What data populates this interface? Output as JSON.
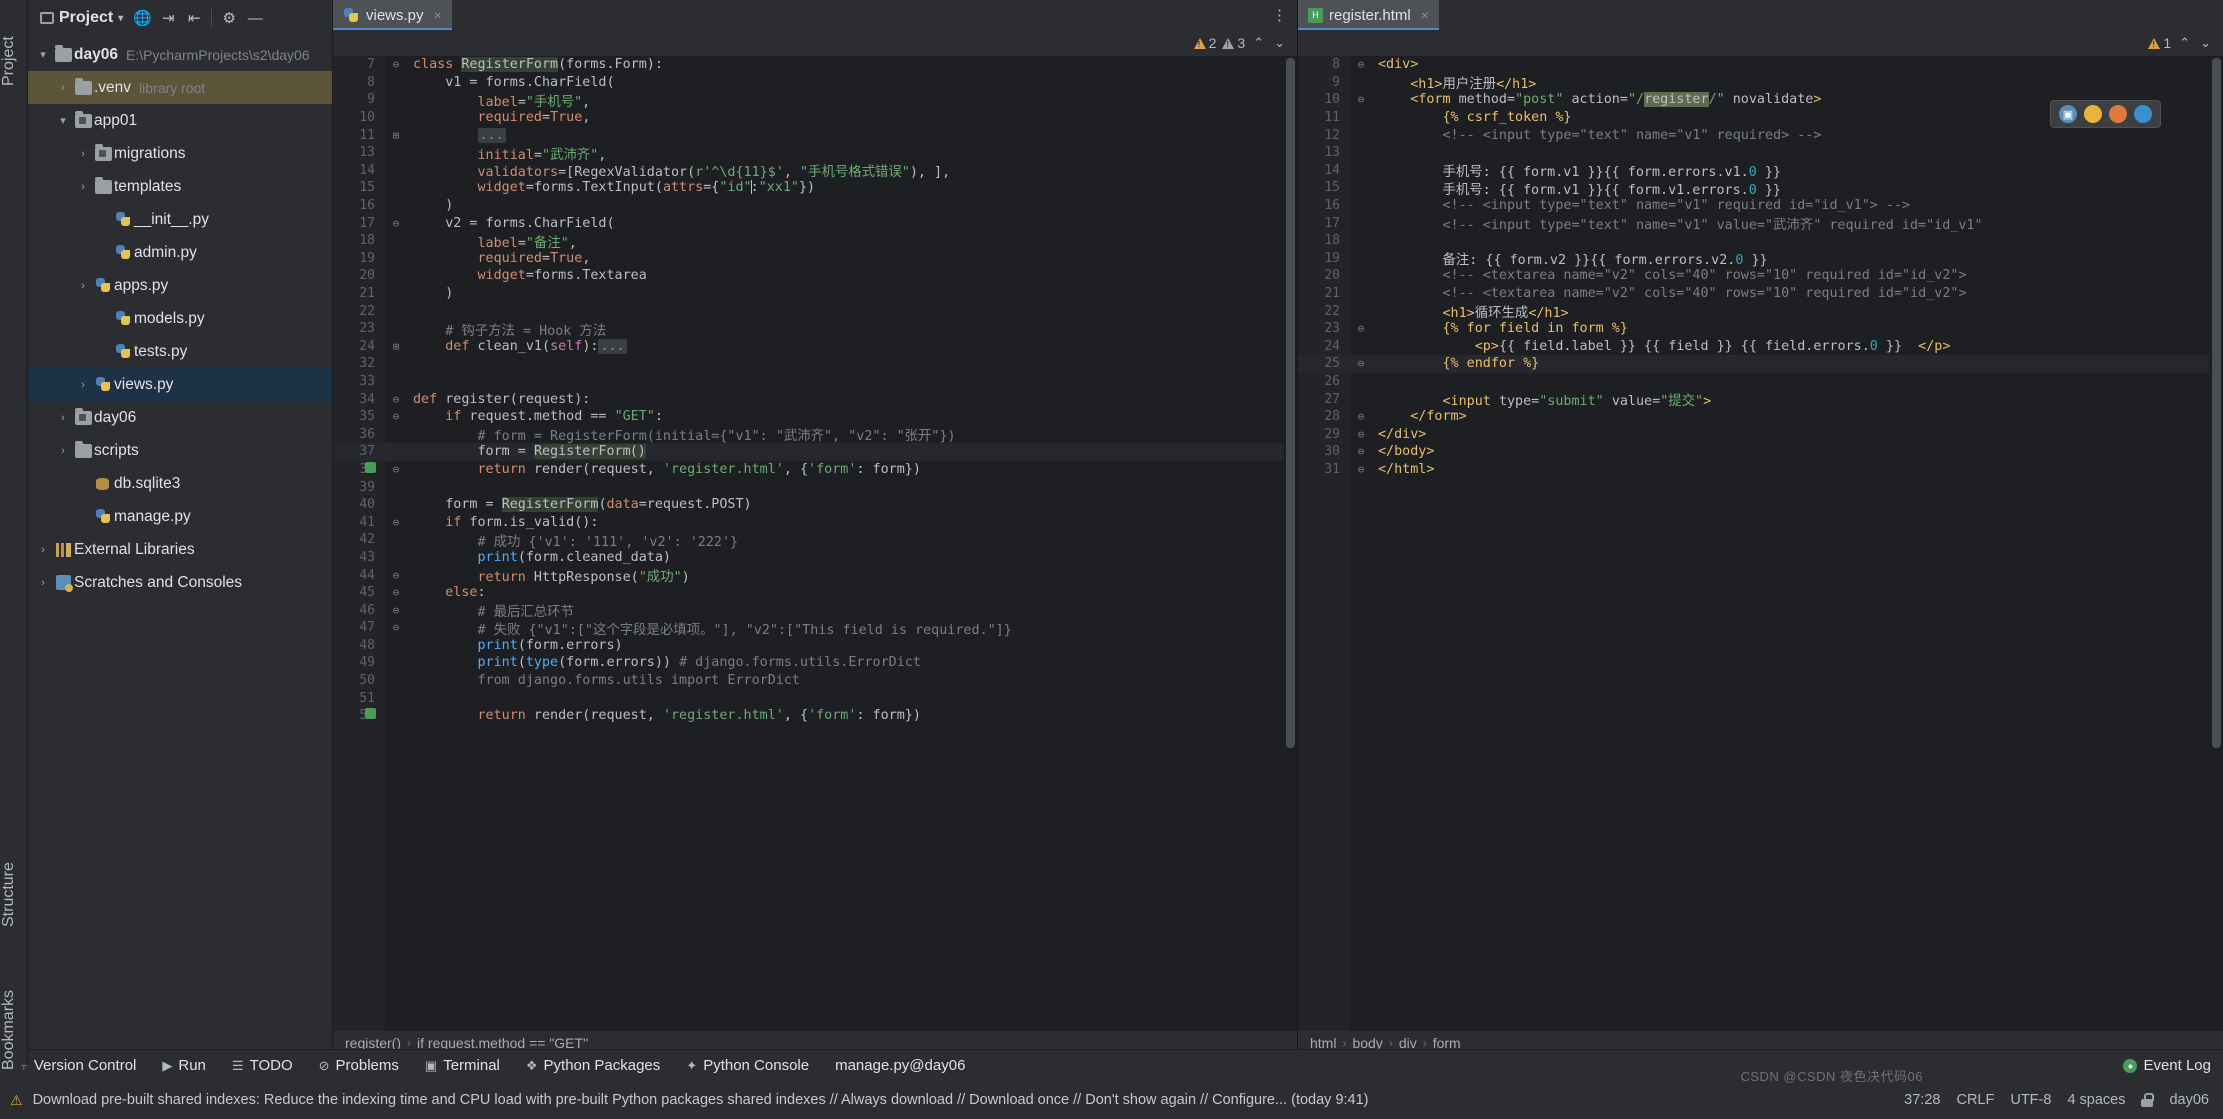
{
  "project_panel": {
    "title": "Project",
    "toolbar_icons": [
      "project-view-icon",
      "globe-icon",
      "collapse-icon",
      "expand-icon",
      "gear-icon",
      "minimize-icon"
    ],
    "tree": [
      {
        "label": "day06",
        "tag": "E:\\PycharmProjects\\s2\\day06",
        "icon": "folder-icon",
        "arrow": "▾",
        "indent": 0,
        "bold": true,
        "state": "normal"
      },
      {
        "label": ".venv",
        "tag": "library root",
        "icon": "folder-icon",
        "arrow": "›",
        "indent": 1,
        "bold": false,
        "state": "venv"
      },
      {
        "label": "app01",
        "tag": "",
        "icon": "module-folder-icon",
        "arrow": "▾",
        "indent": 1,
        "bold": false,
        "state": "normal"
      },
      {
        "label": "migrations",
        "tag": "",
        "icon": "module-folder-icon",
        "arrow": "›",
        "indent": 2,
        "bold": false,
        "state": "normal"
      },
      {
        "label": "templates",
        "tag": "",
        "icon": "folder-icon",
        "arrow": "›",
        "indent": 2,
        "bold": false,
        "state": "normal"
      },
      {
        "label": "__init__.py",
        "tag": "",
        "icon": "python-file-icon",
        "arrow": "",
        "indent": 3,
        "bold": false,
        "state": "normal"
      },
      {
        "label": "admin.py",
        "tag": "",
        "icon": "python-file-icon",
        "arrow": "",
        "indent": 3,
        "bold": false,
        "state": "normal"
      },
      {
        "label": "apps.py",
        "tag": "",
        "icon": "python-file-icon",
        "arrow": "›",
        "indent": 2,
        "bold": false,
        "state": "normal"
      },
      {
        "label": "models.py",
        "tag": "",
        "icon": "python-file-icon",
        "arrow": "",
        "indent": 3,
        "bold": false,
        "state": "normal"
      },
      {
        "label": "tests.py",
        "tag": "",
        "icon": "python-file-icon",
        "arrow": "",
        "indent": 3,
        "bold": false,
        "state": "normal"
      },
      {
        "label": "views.py",
        "tag": "",
        "icon": "python-file-icon",
        "arrow": "›",
        "indent": 2,
        "bold": false,
        "state": "selected"
      },
      {
        "label": "day06",
        "tag": "",
        "icon": "module-folder-icon",
        "arrow": "›",
        "indent": 1,
        "bold": false,
        "state": "normal"
      },
      {
        "label": "scripts",
        "tag": "",
        "icon": "folder-icon",
        "arrow": "›",
        "indent": 1,
        "bold": false,
        "state": "normal"
      },
      {
        "label": "db.sqlite3",
        "tag": "",
        "icon": "database-file-icon",
        "arrow": "",
        "indent": 2,
        "bold": false,
        "state": "normal"
      },
      {
        "label": "manage.py",
        "tag": "",
        "icon": "python-file-icon",
        "arrow": "",
        "indent": 2,
        "bold": false,
        "state": "normal"
      },
      {
        "label": "External Libraries",
        "tag": "",
        "icon": "library-icon",
        "arrow": "›",
        "indent": 0,
        "bold": false,
        "state": "normal"
      },
      {
        "label": "Scratches and Consoles",
        "tag": "",
        "icon": "scratches-icon",
        "arrow": "›",
        "indent": 0,
        "bold": false,
        "state": "normal"
      }
    ]
  },
  "left_editor": {
    "tab": {
      "label": "views.py",
      "icon": "python-file-icon",
      "close": "×"
    },
    "inspections": {
      "warning_count": "2",
      "weak_warning_count": "3",
      "up": "⌃",
      "down": "⌄"
    },
    "breadcrumb": [
      "register()",
      "if request.method == \"GET\""
    ],
    "lines": [
      {
        "n": "7",
        "fold": "⊖",
        "html": "<span class=\"kw\">class</span> <span class=\"hl\">RegisterForm</span>(forms.Form):"
      },
      {
        "n": "8",
        "fold": "",
        "html": "    v1 = forms.CharField("
      },
      {
        "n": "9",
        "fold": "",
        "html": "        <span class=\"kwarg\">label</span>=<span class=\"str\">\"手机号\"</span>,"
      },
      {
        "n": "10",
        "fold": "",
        "html": "        <span class=\"kwarg\">required</span>=<span class=\"kw\">True</span>,"
      },
      {
        "n": "11",
        "fold": "⊞",
        "html": "        <span class=\"ellip\">...</span>"
      },
      {
        "n": "13",
        "fold": "",
        "html": "        <span class=\"kwarg\">initial</span>=<span class=\"str\">\"武沛齐\"</span>,"
      },
      {
        "n": "14",
        "fold": "",
        "html": "        <span class=\"kwarg\">validators</span>=[RegexValidator(<span class=\"str\">r'^\\d{11}$'</span>, <span class=\"str\">\"手机号格式错误\"</span>), ],"
      },
      {
        "n": "15",
        "fold": "",
        "html": "        <span class=\"kwarg\">widget</span>=forms.TextInput(<span class=\"kwarg\">attrs</span>={<span class=\"str\">\"id\"</span><span class=\"caret\"></span>:<span class=\"str\">\"xx1\"</span>})"
      },
      {
        "n": "16",
        "fold": "",
        "html": "    )"
      },
      {
        "n": "17",
        "fold": "⊖",
        "html": "    v2 = forms.CharField("
      },
      {
        "n": "18",
        "fold": "",
        "html": "        <span class=\"kwarg\">label</span>=<span class=\"str\">\"备注\"</span>,"
      },
      {
        "n": "19",
        "fold": "",
        "html": "        <span class=\"kwarg\">required</span>=<span class=\"kw\">True</span>,"
      },
      {
        "n": "20",
        "fold": "",
        "html": "        <span class=\"kwarg\">widget</span>=forms.Textarea"
      },
      {
        "n": "21",
        "fold": "",
        "html": "    )"
      },
      {
        "n": "22",
        "fold": "",
        "html": ""
      },
      {
        "n": "23",
        "fold": "",
        "html": "    <span class=\"cmt\"># 钩子方法 = Hook 方法</span>"
      },
      {
        "n": "24",
        "fold": "⊞",
        "html": "    <span class=\"kw\">def</span> <span class=\"cls\">clean_v1</span>(<span class=\"self\">self</span>):<span class=\"ellip\">...</span>"
      },
      {
        "n": "32",
        "fold": "",
        "html": ""
      },
      {
        "n": "33",
        "fold": "",
        "html": ""
      },
      {
        "n": "34",
        "fold": "⊖",
        "html": "<span class=\"kw\">def</span> <span class=\"cls\">register</span>(request):"
      },
      {
        "n": "35",
        "fold": "⊖",
        "html": "    <span class=\"kw\">if</span> request.method == <span class=\"str\">\"GET\"</span>:"
      },
      {
        "n": "36",
        "fold": "",
        "html": "        <span class=\"cmt\"># form = RegisterForm(initial={\"v1\": \"武沛齐\", \"v2\": \"张开\"})</span>"
      },
      {
        "n": "37",
        "fold": "",
        "html": "        form = <span class=\"hl\">RegisterForm</span><span class=\"caret\"></span><span class=\"hl\">()</span>",
        "current": true
      },
      {
        "n": "38",
        "fold": "⊖",
        "html": "        <span class=\"kw\">return</span> render(request, <span class=\"str\">'register.html'</span>, {<span class=\"str\">'form'</span>: form})",
        "gmark": true
      },
      {
        "n": "39",
        "fold": "",
        "html": ""
      },
      {
        "n": "40",
        "fold": "",
        "html": "    form = <span class=\"hl\">RegisterForm</span>(<span class=\"kwarg\">data</span>=request.POST)"
      },
      {
        "n": "41",
        "fold": "⊖",
        "html": "    <span class=\"kw\">if</span> form.is_valid():"
      },
      {
        "n": "42",
        "fold": "",
        "html": "        <span class=\"cmt\"># 成功 {'v1': '111', 'v2': '222'}</span>"
      },
      {
        "n": "43",
        "fold": "",
        "html": "        <span class=\"fn\">print</span>(form.cleaned_data)"
      },
      {
        "n": "44",
        "fold": "⊖",
        "html": "        <span class=\"kw\">return</span> HttpResponse(<span class=\"str\">\"成功\"</span>)"
      },
      {
        "n": "45",
        "fold": "⊖",
        "html": "    <span class=\"kw\">else</span>:"
      },
      {
        "n": "46",
        "fold": "⊖",
        "html": "        <span class=\"cmt\"># 最后汇总环节</span>"
      },
      {
        "n": "47",
        "fold": "⊖",
        "html": "        <span class=\"cmt\"># 失败 {\"v1\":[\"这个字段是必填项。\"], \"v2\":[\"This field is required.\"]}</span>"
      },
      {
        "n": "48",
        "fold": "",
        "html": "        <span class=\"fn\">print</span>(form.errors)"
      },
      {
        "n": "49",
        "fold": "",
        "html": "        <span class=\"fn\">print</span>(<span class=\"fn\">type</span>(form.errors)) <span class=\"cmt\"># django.forms.utils.ErrorDict</span>"
      },
      {
        "n": "50",
        "fold": "",
        "html": "        <span class=\"cmt\">from django.forms.utils import ErrorDict</span>"
      },
      {
        "n": "51",
        "fold": "",
        "html": ""
      },
      {
        "n": "52",
        "fold": "",
        "html": "        <span class=\"kw\">return</span> render(request, <span class=\"str\">'register.html'</span>, {<span class=\"str\">'form'</span>: form})",
        "gmark": true
      }
    ]
  },
  "right_editor": {
    "tab": {
      "label": "register.html",
      "icon": "html-file-icon",
      "close": "×"
    },
    "inspections": {
      "warning_count": "1",
      "up": "⌃",
      "down": "⌄"
    },
    "breadcrumb": [
      "html",
      "body",
      "div",
      "form"
    ],
    "browser_icons": [
      "browser-preview-icon",
      "chrome-icon",
      "firefox-icon",
      "edge-icon"
    ],
    "lines": [
      {
        "n": "8",
        "fold": "⊖",
        "html": "<span class=\"htag\">&lt;div&gt;</span>"
      },
      {
        "n": "9",
        "fold": "",
        "html": "    <span class=\"htag\">&lt;h1&gt;</span><span class=\"htext\">用户注册</span><span class=\"htag\">&lt;/h1&gt;</span>"
      },
      {
        "n": "10",
        "fold": "⊖",
        "html": "    <span class=\"htag\">&lt;form</span> <span class=\"hattr\">method=</span><span class=\"hstr\">\"post\"</span> <span class=\"hattr\">action=</span><span class=\"hstr\">\"/</span><span class=\"hsel\">register</span><span class=\"hstr\">/\"</span> <span class=\"hattr\">novalidate</span><span class=\"htag\">&gt;</span>"
      },
      {
        "n": "11",
        "fold": "",
        "html": "        <span class=\"hdj\">{% csrf_token %}</span>"
      },
      {
        "n": "12",
        "fold": "",
        "html": "        <span class=\"hcmt\">&lt;!-- &lt;input type=\"text\" name=\"v1\" required&gt; --&gt;</span>"
      },
      {
        "n": "13",
        "fold": "",
        "html": ""
      },
      {
        "n": "14",
        "fold": "",
        "html": "        <span class=\"htext\">手机号: {{ form.v1 }}{{ form.errors.v1.</span><span class=\"num\">0</span><span class=\"htext\"> }}</span>"
      },
      {
        "n": "15",
        "fold": "",
        "html": "        <span class=\"htext\">手机号: {{ form.v1 }}{{ form.v1.errors.</span><span class=\"num\">0</span><span class=\"htext\"> }}</span>"
      },
      {
        "n": "16",
        "fold": "",
        "html": "        <span class=\"hcmt\">&lt;!-- &lt;input type=\"text\" name=\"v1\" required id=\"id_v1\"&gt; --&gt;</span>"
      },
      {
        "n": "17",
        "fold": "",
        "html": "        <span class=\"hcmt\">&lt;!-- &lt;input type=\"text\" name=\"v1\" value=\"武沛齐\" required id=\"id_v1\"</span>"
      },
      {
        "n": "18",
        "fold": "",
        "html": ""
      },
      {
        "n": "19",
        "fold": "",
        "html": "        <span class=\"htext\">备注: {{ form.v2 }}{{ form.errors.v2.</span><span class=\"num\">0</span><span class=\"htext\"> }}</span>"
      },
      {
        "n": "20",
        "fold": "",
        "html": "        <span class=\"hcmt\">&lt;!-- &lt;textarea name=\"v2\" cols=\"40\" rows=\"10\" required id=\"id_v2\"&gt;</span>"
      },
      {
        "n": "21",
        "fold": "",
        "html": "        <span class=\"hcmt\">&lt;!-- &lt;textarea name=\"v2\" cols=\"40\" rows=\"10\" required id=\"id_v2\"&gt;</span>"
      },
      {
        "n": "22",
        "fold": "",
        "html": "        <span class=\"htag\">&lt;h1&gt;</span><span class=\"htext\">循环生成</span><span class=\"htag\">&lt;/h1&gt;</span>"
      },
      {
        "n": "23",
        "fold": "⊖",
        "html": "        <span class=\"hdj\">{% for field in form %}</span>"
      },
      {
        "n": "24",
        "fold": "",
        "html": "            <span class=\"htag\">&lt;p&gt;</span><span class=\"htext\">{{ field.label }} {{ field }} {{ field.errors.</span><span class=\"num\">0</span><span class=\"htext\"> }}  </span><span class=\"htag\">&lt;/p&gt;</span>"
      },
      {
        "n": "25",
        "fold": "⊖",
        "html": "        <span class=\"hdj\">{% endfor %}</span>",
        "current": true
      },
      {
        "n": "26",
        "fold": "",
        "html": ""
      },
      {
        "n": "27",
        "fold": "",
        "html": "        <span class=\"htag\">&lt;input</span> <span class=\"hattr\">type=</span><span class=\"hstr\">\"submit\"</span> <span class=\"hattr\">value=</span><span class=\"hstr\">\"提交\"</span><span class=\"htag\">&gt;</span>"
      },
      {
        "n": "28",
        "fold": "⊖",
        "html": "    <span class=\"htag\">&lt;/form&gt;</span>"
      },
      {
        "n": "29",
        "fold": "⊖",
        "html": "<span class=\"htag\">&lt;/div&gt;</span>"
      },
      {
        "n": "30",
        "fold": "⊖",
        "html": "<span class=\"htag\">&lt;/body&gt;</span>"
      },
      {
        "n": "31",
        "fold": "⊖",
        "html": "<span class=\"htag\">&lt;/html&gt;</span>"
      }
    ]
  },
  "left_strip": {
    "project_label": "Project",
    "structure_label": "Structure",
    "bookmarks_label": "Bookmarks"
  },
  "bottom_toolwindows": [
    {
      "label": "Version Control",
      "icon": "branch-icon"
    },
    {
      "label": "Run",
      "icon": "run-icon"
    },
    {
      "label": "TODO",
      "icon": "todo-icon"
    },
    {
      "label": "Problems",
      "icon": "problems-icon"
    },
    {
      "label": "Terminal",
      "icon": "terminal-icon"
    },
    {
      "label": "Python Packages",
      "icon": "packages-icon"
    },
    {
      "label": "Python Console",
      "icon": "console-icon"
    },
    {
      "label": "manage.py@day06",
      "icon": ""
    }
  ],
  "event_log": {
    "label": "Event Log",
    "icon": "bell-icon"
  },
  "status_bar": {
    "message": "Download pre-built shared indexes: Reduce the indexing time and CPU load with pre-built Python packages shared indexes // Always download // Download once // Don't show again // Configure... (today 9:41)",
    "position": "37:28",
    "line_separator": "CRLF",
    "encoding": "UTF-8",
    "indent": "4 spaces",
    "branch": "day06",
    "lock_icon": "lock-icon",
    "watermark": "CSDN @CSDN 夜色决代码06"
  }
}
